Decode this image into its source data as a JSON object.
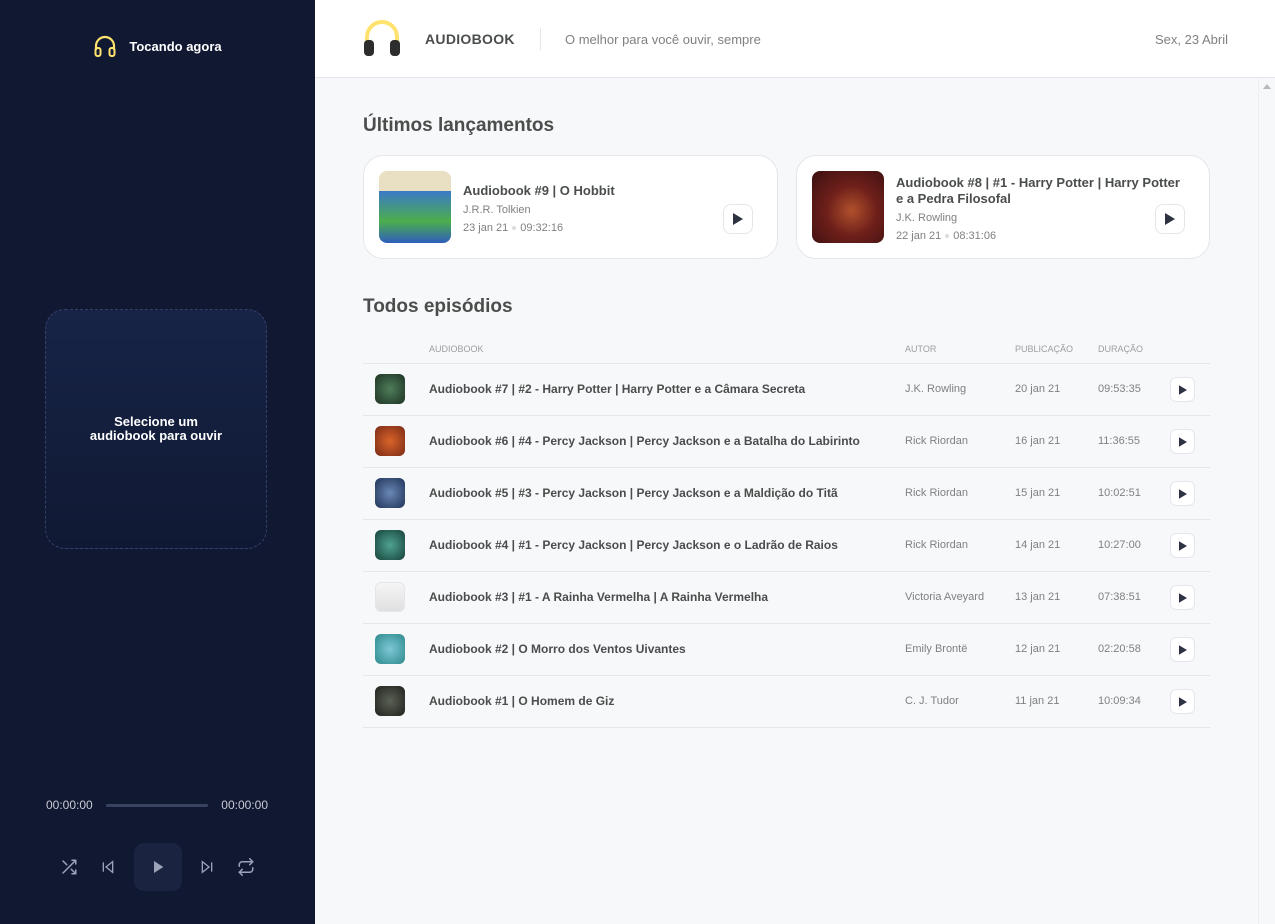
{
  "player": {
    "header_label": "Tocando agora",
    "empty_message": "Selecione um audiobook para ouvir",
    "time_current": "00:00:00",
    "time_total": "00:00:00",
    "progress": 0
  },
  "header": {
    "brand": "AUDIOBOOK",
    "tagline": "O melhor para você ouvir, sempre",
    "date": "Sex, 23 Abril"
  },
  "latest": {
    "title": "Últimos lançamentos",
    "items": [
      {
        "title": "Audiobook #9 | O Hobbit",
        "author": "J.R.R. Tolkien",
        "date": "23 jan 21",
        "duration": "09:32:16"
      },
      {
        "title": "Audiobook #8 | #1 - Harry Potter | Harry Potter e a Pedra Filosofal",
        "author": "J.K. Rowling",
        "date": "22 jan 21",
        "duration": "08:31:06"
      }
    ]
  },
  "episodes": {
    "title": "Todos episódios",
    "columns": {
      "audiobook": "AUDIOBOOK",
      "author": "AUTOR",
      "published": "PUBLICAÇÃO",
      "duration": "DURAÇÃO"
    },
    "rows": [
      {
        "title": "Audiobook #7 | #2 - Harry Potter | Harry Potter e a Câmara Secreta",
        "author": "J.K. Rowling",
        "published": "20 jan 21",
        "duration": "09:53:35"
      },
      {
        "title": "Audiobook #6 | #4 - Percy Jackson | Percy Jackson e a Batalha do Labirinto",
        "author": "Rick Riordan",
        "published": "16 jan 21",
        "duration": "11:36:55"
      },
      {
        "title": "Audiobook #5 | #3 - Percy Jackson | Percy Jackson e a Maldição do Titã",
        "author": "Rick Riordan",
        "published": "15 jan 21",
        "duration": "10:02:51"
      },
      {
        "title": "Audiobook #4 | #1 - Percy Jackson | Percy Jackson e o Ladrão de Raios",
        "author": "Rick Riordan",
        "published": "14 jan 21",
        "duration": "10:27:00"
      },
      {
        "title": "Audiobook #3 | #1 - A Rainha Vermelha | A Rainha Vermelha",
        "author": "Victoria Aveyard",
        "published": "13 jan 21",
        "duration": "07:38:51"
      },
      {
        "title": "Audiobook #2 | O Morro dos Ventos Uivantes",
        "author": "Emily Brontë",
        "published": "12 jan 21",
        "duration": "02:20:58"
      },
      {
        "title": "Audiobook #1 | O Homem de Giz",
        "author": "C. J. Tudor",
        "published": "11 jan 21",
        "duration": "10:09:34"
      }
    ]
  },
  "colors": {
    "sidebar_bg": "#111831",
    "accent_yellow": "#ffe36e",
    "text_dark": "#494d4b",
    "text_muted": "#808080"
  },
  "icons": [
    "headphones-icon",
    "shuffle-icon",
    "previous-icon",
    "play-icon",
    "next-icon",
    "repeat-icon"
  ]
}
